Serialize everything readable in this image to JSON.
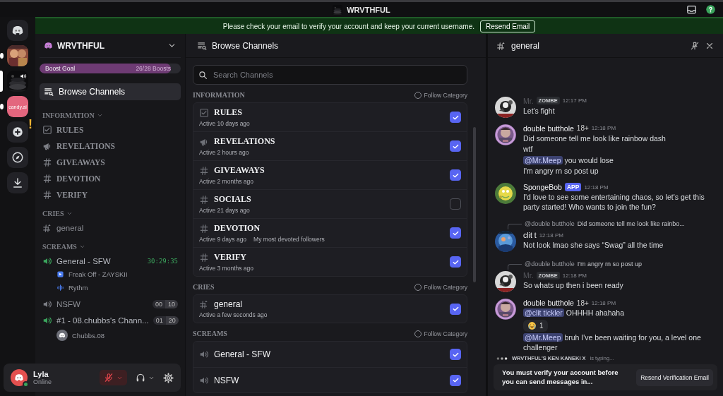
{
  "titlebar": {
    "title": "WRVTHFUL"
  },
  "servers": [
    {
      "kind": "home",
      "selected": false,
      "unread": false
    },
    {
      "kind": "picture",
      "selected": false,
      "unread": true
    },
    {
      "kind": "picture",
      "selected": true,
      "unread": false,
      "voice": true
    },
    {
      "kind": "text-logo",
      "label": "candy.ai",
      "selected": false,
      "unread": true
    },
    {
      "kind": "add",
      "alert": "!",
      "selected": false,
      "unread": false
    },
    {
      "kind": "discover",
      "selected": false,
      "unread": false
    },
    {
      "kind": "download",
      "selected": false,
      "unread": false
    }
  ],
  "banner": {
    "text": "Please check your email to verify your account and keep your current username.",
    "button": "Resend Email"
  },
  "sidebar": {
    "server_name": "WRVTHFUL",
    "boost": {
      "label": "Boost Goal",
      "count": "26/28 Boosts",
      "level": 0.93
    },
    "browse": {
      "label": "Browse Channels",
      "selected": true
    },
    "categories": [
      {
        "name": "INFORMATION",
        "channels": [
          {
            "kind": "rules",
            "name": "RULES",
            "serif": true
          },
          {
            "kind": "announce",
            "name": "REVELATIONS",
            "serif": true
          },
          {
            "kind": "text",
            "name": "GIVEAWAYS",
            "serif": true
          },
          {
            "kind": "text",
            "name": "DEVOTION",
            "serif": true
          },
          {
            "kind": "text",
            "name": "VERIFY",
            "serif": true
          }
        ]
      },
      {
        "name": "CRIES",
        "channels": [
          {
            "kind": "thread",
            "name": "general",
            "serif": false
          }
        ]
      },
      {
        "name": "SCREAMS",
        "channels": [
          {
            "kind": "voice",
            "name": "General - SFW",
            "serif": false,
            "active": true,
            "timer": "30:29:35",
            "members": [
              {
                "kind": "activity",
                "name": "Freak Off - ZAYSKII"
              },
              {
                "kind": "bot",
                "name": "Rythm"
              }
            ]
          },
          {
            "kind": "voice",
            "name": "NSFW",
            "serif": false,
            "active": false,
            "counts": [
              "00",
              "10"
            ]
          },
          {
            "kind": "voice",
            "name": "#1 - 08.chubbs's Chann...",
            "serif": false,
            "active": true,
            "counts": [
              "01",
              "20"
            ],
            "members": [
              {
                "kind": "user",
                "name": "Chubbs.08"
              }
            ]
          }
        ]
      }
    ]
  },
  "user_panel": {
    "name": "Lyla",
    "status": "Online",
    "muted": true
  },
  "browse": {
    "title": "Browse Channels",
    "search": {
      "placeholder": "Search Channels"
    },
    "sections": [
      {
        "name": "INFORMATION",
        "follow": "Follow Category",
        "following": false,
        "channels": [
          {
            "kind": "rules",
            "name": "RULES",
            "serif": true,
            "activity": "Active 10 days ago",
            "checked": true
          },
          {
            "kind": "announce",
            "name": "REVELATIONS",
            "serif": true,
            "activity": "Active 2 hours ago",
            "checked": true
          },
          {
            "kind": "text",
            "name": "GIVEAWAYS",
            "serif": true,
            "activity": "Active 2 months ago",
            "checked": true
          },
          {
            "kind": "text",
            "name": "SOCIALS",
            "serif": true,
            "activity": "Active 21 days ago",
            "checked": false
          },
          {
            "kind": "text",
            "name": "DEVOTION",
            "serif": true,
            "activity": "Active 9 days ago",
            "topic": "My most devoted followers",
            "checked": true
          },
          {
            "kind": "text",
            "name": "VERIFY",
            "serif": true,
            "activity": "Active 3 months ago",
            "checked": true
          }
        ]
      },
      {
        "name": "CRIES",
        "follow": "Follow Category",
        "following": false,
        "channels": [
          {
            "kind": "thread",
            "name": "general",
            "serif": false,
            "activity": "Active a few seconds ago",
            "checked": true
          }
        ]
      },
      {
        "name": "SCREAMS",
        "follow": "Follow Category",
        "following": false,
        "channels": [
          {
            "kind": "voice",
            "name": "General - SFW",
            "serif": false,
            "checked": true
          },
          {
            "kind": "voice",
            "name": "NSFW",
            "serif": false,
            "checked": true
          }
        ]
      }
    ]
  },
  "chat": {
    "channel": "general",
    "messages": [
      {
        "author": "Mr.",
        "dim": true,
        "tag": {
          "kind": "clan",
          "text": "ZOMBE"
        },
        "time": "12:17 PM",
        "lines": [
          {
            "kind": "text",
            "text": "Let's fight"
          }
        ]
      },
      {
        "author": "double butthole",
        "suffix": "18+",
        "time": "12:18 PM",
        "lines": [
          {
            "kind": "text",
            "text": "Did someone tell me  look like rainbow dash"
          },
          {
            "kind": "text",
            "text": "wtf"
          },
          {
            "kind": "text",
            "mention": "@Mr.Meep",
            "text": " you would lose"
          },
          {
            "kind": "text",
            "text": "I'm angry rn so post up"
          }
        ]
      },
      {
        "author": "SpongeBob",
        "tag": {
          "kind": "app",
          "text": "APP"
        },
        "time": "12:18 PM",
        "lines": [
          {
            "kind": "text",
            "text": "I'd love to see some entertaining chaos, so let's get this party started! Who wants to join the fun?"
          }
        ]
      },
      {
        "reply": {
          "author": "@double butthole",
          "text": "Did someone tell me  look like rainbo..."
        },
        "author": "clit t",
        "time": "12:18 PM",
        "lines": [
          {
            "kind": "text",
            "text": "Not look lmao she says “Swag” all the time"
          }
        ]
      },
      {
        "reply": {
          "author": "@double butthole",
          "text": "I'm angry rn so post up"
        },
        "author": "Mr.",
        "dim": true,
        "tag": {
          "kind": "clan",
          "text": "ZOMBE"
        },
        "time": "12:18 PM",
        "lines": [
          {
            "kind": "text",
            "text": "So whats up then i been ready"
          }
        ]
      },
      {
        "author": "double butthole",
        "suffix": "18+",
        "time": "12:18 PM",
        "lines": [
          {
            "kind": "text",
            "mention": "@clit tickler",
            "text": " OHHHH ahahaha"
          },
          {
            "kind": "reaction",
            "count": "1"
          },
          {
            "kind": "text",
            "mention": "@Mr.Meep",
            "text": " bruh I've been waiting for you, a level one challenger"
          }
        ]
      }
    ],
    "typing": {
      "user": "WRVTHFUL'S KEN KANEKI X",
      "text": "is typing..."
    },
    "verify": {
      "text": "You must verify your account before you can send messages in...",
      "button": "Resend Verification Email"
    }
  }
}
